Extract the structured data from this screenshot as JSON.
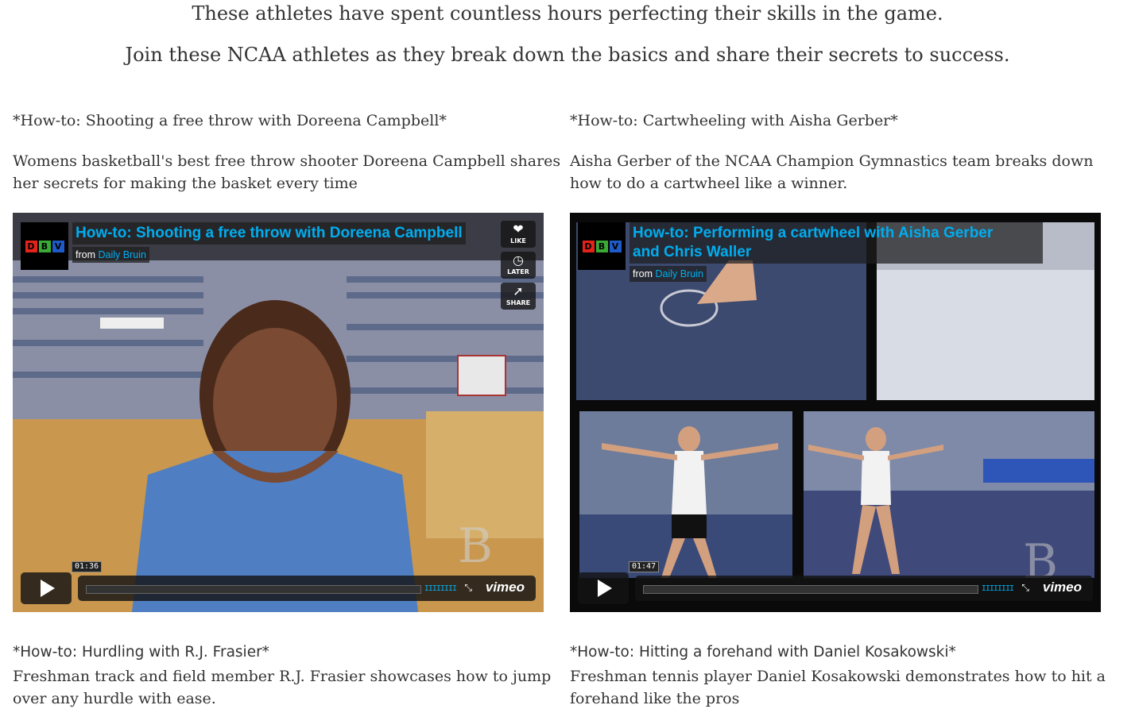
{
  "intro": {
    "line1": "These athletes have spent countless hours perfecting their skills in the game.",
    "line2": "Join these NCAA athletes as they break down the basics and share their secrets to success."
  },
  "posts": [
    {
      "title": "*How-to: Shooting a free throw with Doreena Campbell*",
      "description": "Womens basketball's best free throw shooter Doreena Campbell shares her secrets for making the basket every time",
      "video": {
        "title": "How-to: Shooting a free throw with Doreena Campbell",
        "from_label": "from",
        "from_link": "Daily Bruin",
        "time": "01:36"
      }
    },
    {
      "title": "*How-to: Cartwheeling with Aisha Gerber*",
      "description": "Aisha Gerber of the NCAA Champion Gymnastics team breaks down how to do a cartwheel like a winner.",
      "video": {
        "title_line1": "How-to: Performing a cartwheel with Aisha Gerber",
        "title_line2": "and Chris Waller",
        "from_label": "from",
        "from_link": "Daily Bruin",
        "time": "01:47"
      }
    },
    {
      "title": "*How-to: Hurdling with R.J. Frasier*",
      "description": "Freshman track and field member R.J. Frasier showcases how to jump over any hurdle with ease."
    },
    {
      "title": "*How-to: Hitting a forehand with Daniel Kosakowski*",
      "description": "Freshman tennis player Daniel Kosakowski demonstrates how to hit a forehand like the pros"
    }
  ],
  "player": {
    "logo_letters": [
      "D",
      "B",
      "V"
    ],
    "like_label": "LIKE",
    "later_label": "LATER",
    "share_label": "SHARE",
    "brand": "vimeo",
    "volume_glyph": "IIIIIIII",
    "fullscreen_glyph": "⤡"
  }
}
